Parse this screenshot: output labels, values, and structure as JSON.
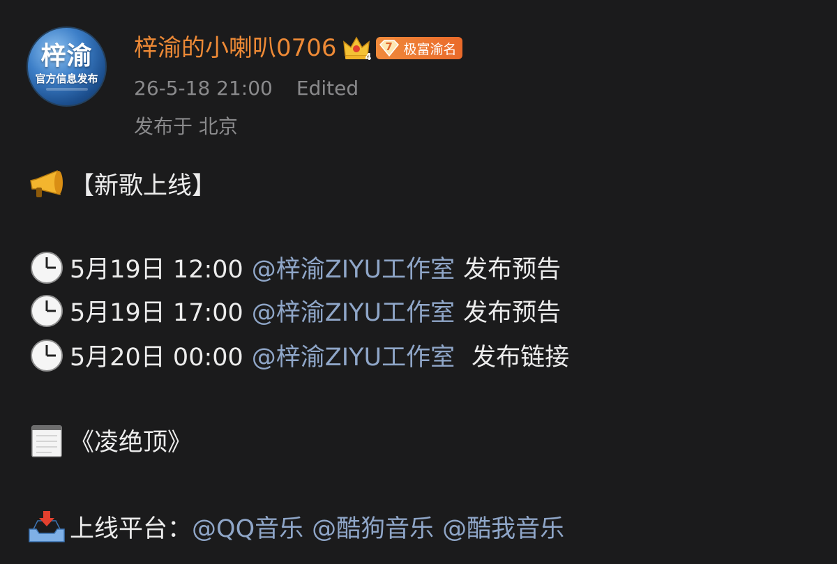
{
  "header": {
    "avatar_line1": "梓渝",
    "avatar_line2": "官方信息发布",
    "username": "梓渝的小喇叭0706",
    "crown_level": "4",
    "level_number": "7",
    "level_label": "极富渝名",
    "timestamp": "26-5-18 21:00",
    "edited": "Edited",
    "location": "发布于 北京"
  },
  "post": {
    "title": "【新歌上线】",
    "schedule": [
      {
        "time": "5月19日 12:00",
        "mention": "@梓渝ZIYU工作室",
        "action": "发布预告"
      },
      {
        "time": "5月19日 17:00",
        "mention": "@梓渝ZIYU工作室",
        "action": "发布预告"
      },
      {
        "time": "5月20日 00:00",
        "mention": "@梓渝ZIYU工作室",
        "action": "发布链接"
      }
    ],
    "song": "《凌绝顶》",
    "platform_label": "上线平台：",
    "platforms": [
      "@QQ音乐",
      "@酷狗音乐",
      "@酷我音乐"
    ]
  },
  "icons": {
    "title_icon": "megaphone-icon",
    "time_icon": "clock-icon",
    "song_icon": "notepad-icon",
    "platform_icon": "inbox-tray-icon",
    "crown_icon": "crown-icon",
    "level_icon": "diamond-badge-icon"
  },
  "colors": {
    "background": "#1b1b1c",
    "username": "#ee8a36",
    "mention": "#8fa6c8",
    "meta": "#8a8a8c",
    "text": "#ececec"
  }
}
